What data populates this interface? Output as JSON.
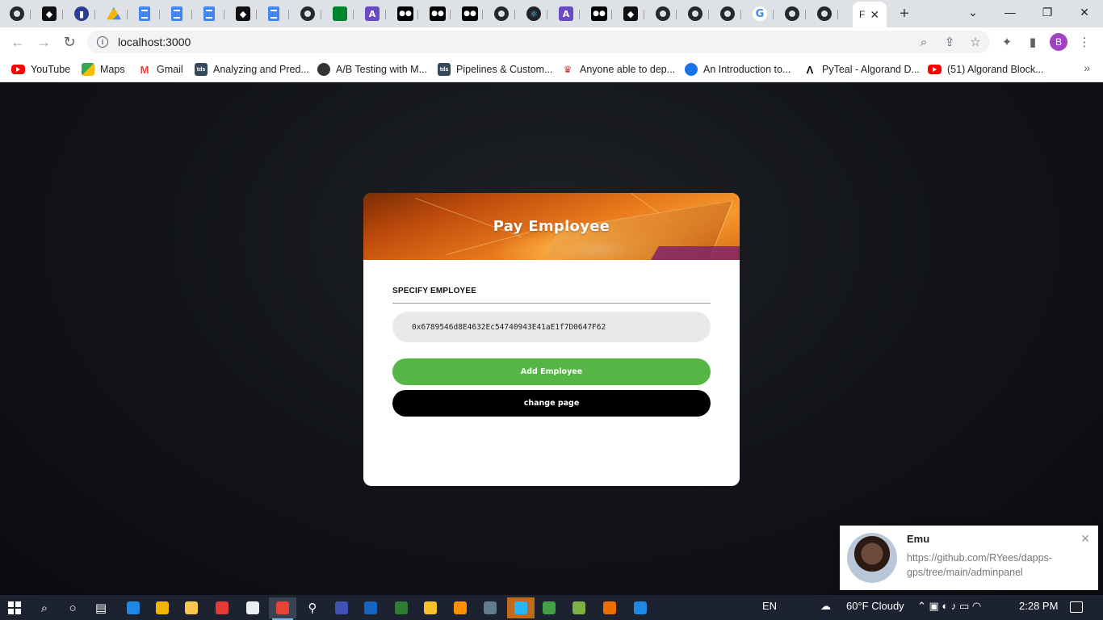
{
  "browser": {
    "tabs": [
      {
        "icon": "github-icon"
      },
      {
        "icon": "algorand-icon"
      },
      {
        "icon": "chart-icon"
      },
      {
        "icon": "google-drive-icon"
      },
      {
        "icon": "google-docs-icon"
      },
      {
        "icon": "google-docs-icon"
      },
      {
        "icon": "google-docs-icon"
      },
      {
        "icon": "algorand-icon"
      },
      {
        "icon": "google-docs-icon"
      },
      {
        "icon": "github-icon"
      },
      {
        "icon": "google-meet-icon"
      },
      {
        "icon": "app-icon"
      },
      {
        "icon": "medium-icon"
      },
      {
        "icon": "medium-icon"
      },
      {
        "icon": "medium-icon"
      },
      {
        "icon": "github-icon"
      },
      {
        "icon": "react-icon"
      },
      {
        "icon": "app-icon"
      },
      {
        "icon": "medium-icon"
      },
      {
        "icon": "algorand-icon"
      },
      {
        "icon": "github-icon"
      },
      {
        "icon": "github-icon"
      },
      {
        "icon": "github-icon"
      },
      {
        "icon": "google-icon"
      },
      {
        "icon": "github-icon"
      },
      {
        "icon": "github-icon"
      }
    ],
    "active_tab": {
      "label": "F",
      "close": "✕"
    },
    "new_tab": "+",
    "address": "localhost:3000",
    "profile_initial": "B",
    "bookmarks": [
      {
        "label": "YouTube",
        "icon": "youtube-icon"
      },
      {
        "label": "Maps",
        "icon": "maps-icon"
      },
      {
        "label": "Gmail",
        "icon": "gmail-icon"
      },
      {
        "label": "Analyzing and Pred...",
        "icon": "tds-icon"
      },
      {
        "label": "A/B Testing with M...",
        "icon": "ab-icon"
      },
      {
        "label": "Pipelines & Custom...",
        "icon": "tds-icon"
      },
      {
        "label": "Anyone able to dep...",
        "icon": "crown-icon"
      },
      {
        "label": "An Introduction to...",
        "icon": "intro-icon"
      },
      {
        "label": "PyTeal - Algorand D...",
        "icon": "pyteal-icon"
      },
      {
        "label": "(51) Algorand Block...",
        "icon": "youtube-icon"
      }
    ]
  },
  "app": {
    "title": "Pay Employee",
    "form_label": "SPECIFY EMPLOYEE",
    "address_value": "0x6789546d8E4632Ec54740943E41aE1f7D0647F62",
    "add_button": "Add Employee",
    "change_button": "change page",
    "colors": {
      "green": "#55b646",
      "black": "#000000",
      "field": "#e9e9e9"
    }
  },
  "notification": {
    "name": "Emu",
    "message": "https://github.com/RYees/dapps-gps/tree/main/adminpanel",
    "close": "✕"
  },
  "taskbar": {
    "language": "EN",
    "weather": "60°F  Cloudy",
    "time": "2:28 PM"
  }
}
